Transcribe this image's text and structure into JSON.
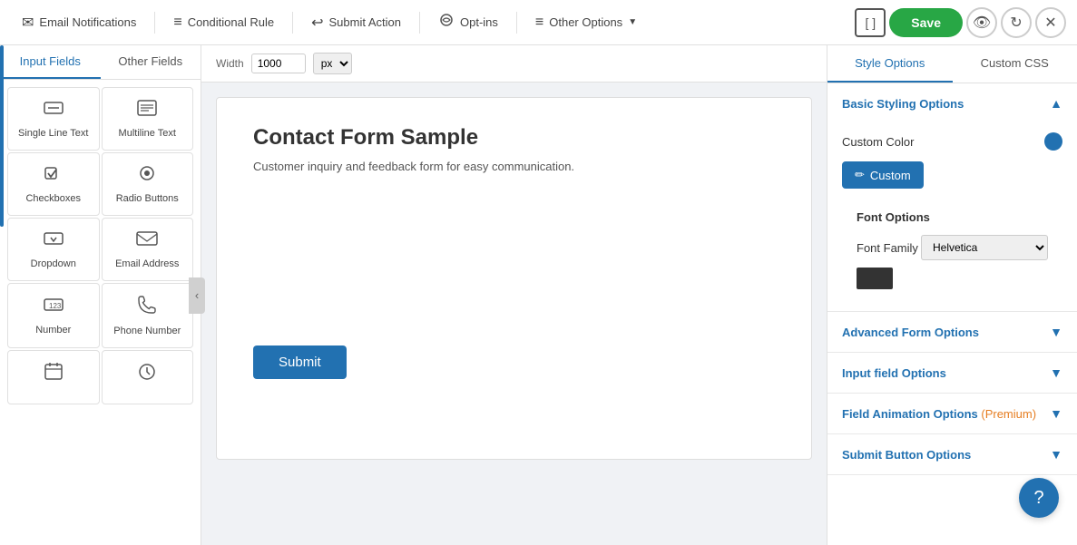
{
  "nav": {
    "items": [
      {
        "id": "email-notifications",
        "icon": "✉",
        "label": "Email Notifications"
      },
      {
        "id": "conditional-rule",
        "icon": "≡",
        "label": "Conditional Rule"
      },
      {
        "id": "submit-action",
        "icon": "↩",
        "label": "Submit Action"
      },
      {
        "id": "opt-ins",
        "icon": "☁",
        "label": "Opt-ins"
      },
      {
        "id": "other-options",
        "icon": "≡",
        "label": "Other Options",
        "has_arrow": true
      }
    ],
    "save_label": "Save",
    "bracket_icon": "[ ]"
  },
  "left_panel": {
    "tabs": [
      {
        "id": "input-fields",
        "label": "Input Fields",
        "active": true
      },
      {
        "id": "other-fields",
        "label": "Other Fields",
        "active": false
      }
    ],
    "fields": [
      {
        "id": "single-line-text",
        "icon": "▭",
        "label": "Single Line Text"
      },
      {
        "id": "multiline-text",
        "icon": "▤",
        "label": "Multiline Text"
      },
      {
        "id": "checkboxes",
        "icon": "☑",
        "label": "Checkboxes"
      },
      {
        "id": "radio-buttons",
        "icon": "⊙",
        "label": "Radio Buttons"
      },
      {
        "id": "dropdown",
        "icon": "⊡",
        "label": "Dropdown"
      },
      {
        "id": "email-address",
        "icon": "✉",
        "label": "Email Address"
      },
      {
        "id": "number",
        "icon": "🔢",
        "label": "Number"
      },
      {
        "id": "phone-number",
        "icon": "📞",
        "label": "Phone Number"
      },
      {
        "id": "date",
        "icon": "📅",
        "label": ""
      },
      {
        "id": "time",
        "icon": "🕐",
        "label": ""
      }
    ]
  },
  "canvas": {
    "width_label": "Width",
    "width_value": "1000",
    "unit": "px",
    "form": {
      "title": "Contact Form Sample",
      "description": "Customer inquiry and feedback form for easy communication.",
      "submit_label": "Submit"
    }
  },
  "right_panel": {
    "tabs": [
      {
        "id": "style-options",
        "label": "Style Options",
        "active": true
      },
      {
        "id": "custom-css",
        "label": "Custom CSS",
        "active": false
      }
    ],
    "basic_styling": {
      "title": "Basic Styling Options",
      "expanded": true,
      "custom_color_label": "Custom Color",
      "custom_button_label": "Custom",
      "font_options_title": "Font Options",
      "font_family_label": "Font Family",
      "font_family_value": "Helvetica"
    },
    "sections": [
      {
        "id": "advanced-form-options",
        "label": "Advanced Form Options",
        "collapsed": true
      },
      {
        "id": "input-field-options",
        "label": "Input field Options",
        "collapsed": true
      },
      {
        "id": "field-animation-options",
        "label": "Field Animation Options",
        "premium": " (Premium)",
        "collapsed": true
      },
      {
        "id": "submit-button-options",
        "label": "Submit Button Options",
        "collapsed": true
      }
    ]
  }
}
